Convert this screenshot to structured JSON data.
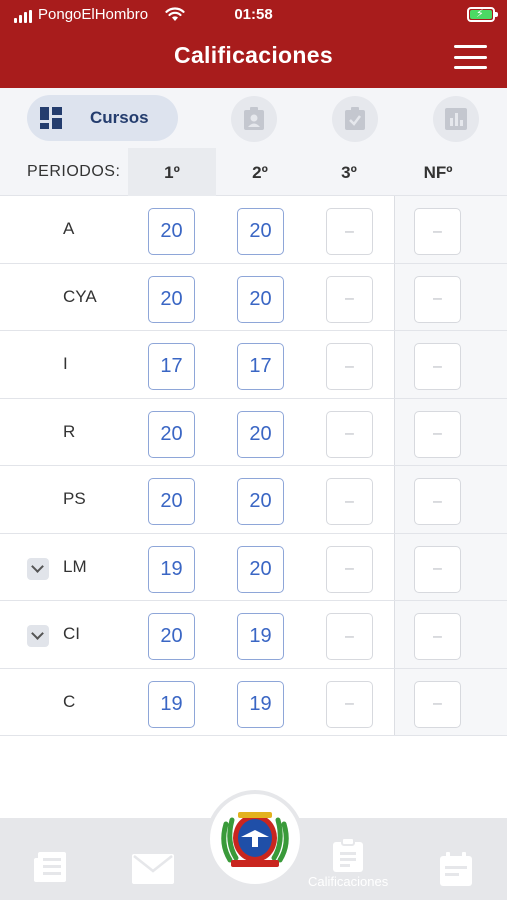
{
  "status": {
    "carrier": "PongoElHombro",
    "time": "01:58"
  },
  "header": {
    "title": "Calificaciones"
  },
  "tabs": {
    "cursos_label": "Cursos"
  },
  "table": {
    "header_label": "PERIODOS:",
    "columns": [
      "1º",
      "2º",
      "3º",
      "NFº"
    ],
    "empty_mark": "–",
    "rows": [
      {
        "name": "A",
        "grades": [
          "20",
          "20"
        ]
      },
      {
        "name": "CYA",
        "grades": [
          "20",
          "20"
        ]
      },
      {
        "name": "I",
        "grades": [
          "17",
          "17"
        ]
      },
      {
        "name": "R",
        "grades": [
          "20",
          "20"
        ]
      },
      {
        "name": "PS",
        "grades": [
          "20",
          "20"
        ]
      },
      {
        "name": "LM",
        "grades": [
          "19",
          "20"
        ]
      },
      {
        "name": "CI",
        "grades": [
          "20",
          "19"
        ]
      },
      {
        "name": "C",
        "grades": [
          "19",
          "19"
        ]
      }
    ]
  },
  "bottom_nav": {
    "active_label": "Calificaciones"
  },
  "colors": {
    "brand": "#a81c1c",
    "accent": "#3a66c4",
    "tab_active": "#243d6e"
  }
}
